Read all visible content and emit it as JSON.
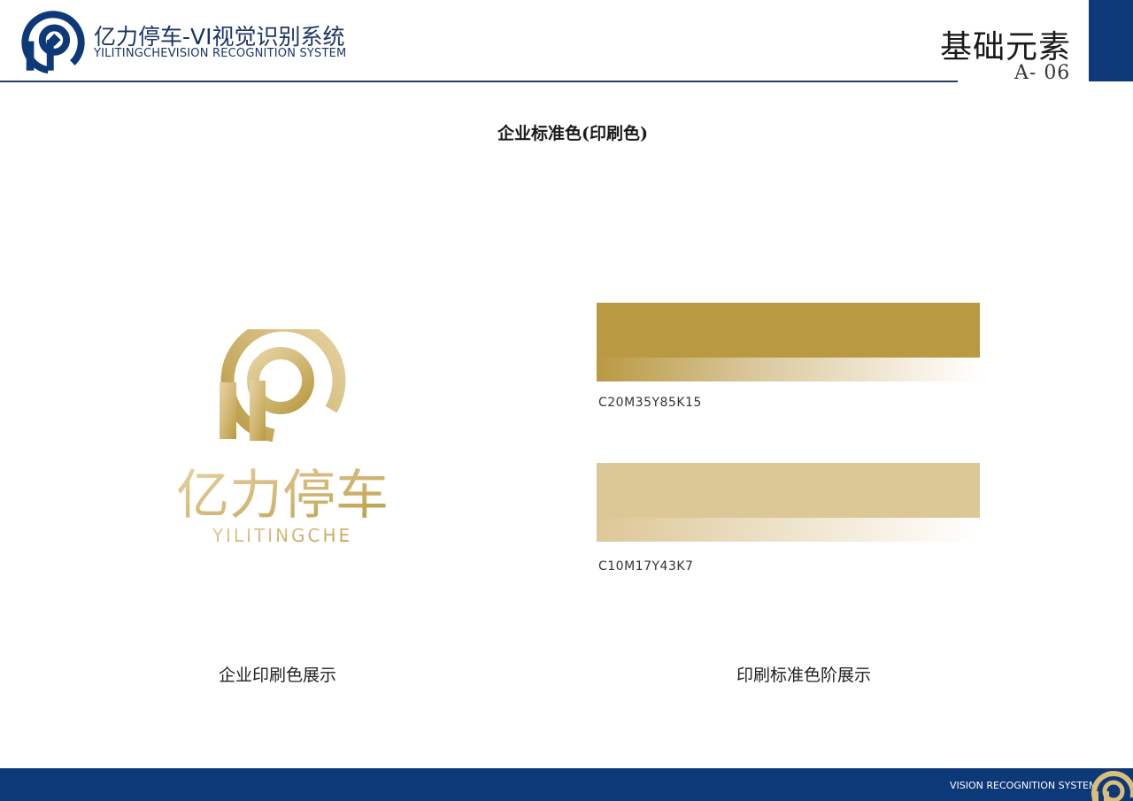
{
  "header": {
    "brand_cn": "亿力停车-VI视觉识别系统",
    "brand_en": "YILITINGCHEVISION RECOGNITION SYSTEM",
    "section_title": "基础元素",
    "section_code": "A- 06"
  },
  "page_heading": "企业标准色(印刷色)",
  "logo": {
    "wordmark_cn": "亿力停车",
    "wordmark_en": "YILITINGCHE"
  },
  "swatches": [
    {
      "code": "C20M35Y85K15",
      "color": "#b99a42"
    },
    {
      "code": "C10M17Y43K7",
      "color": "#dcc796"
    }
  ],
  "captions": {
    "left": "企业印刷色展示",
    "right": "印刷标准色阶展示"
  },
  "footer": {
    "text": "VISION RECOGNITION SYSTEM"
  },
  "colors": {
    "brand_blue": "#0d3978",
    "gold": "#b99a42",
    "light_gold": "#dcc796"
  }
}
